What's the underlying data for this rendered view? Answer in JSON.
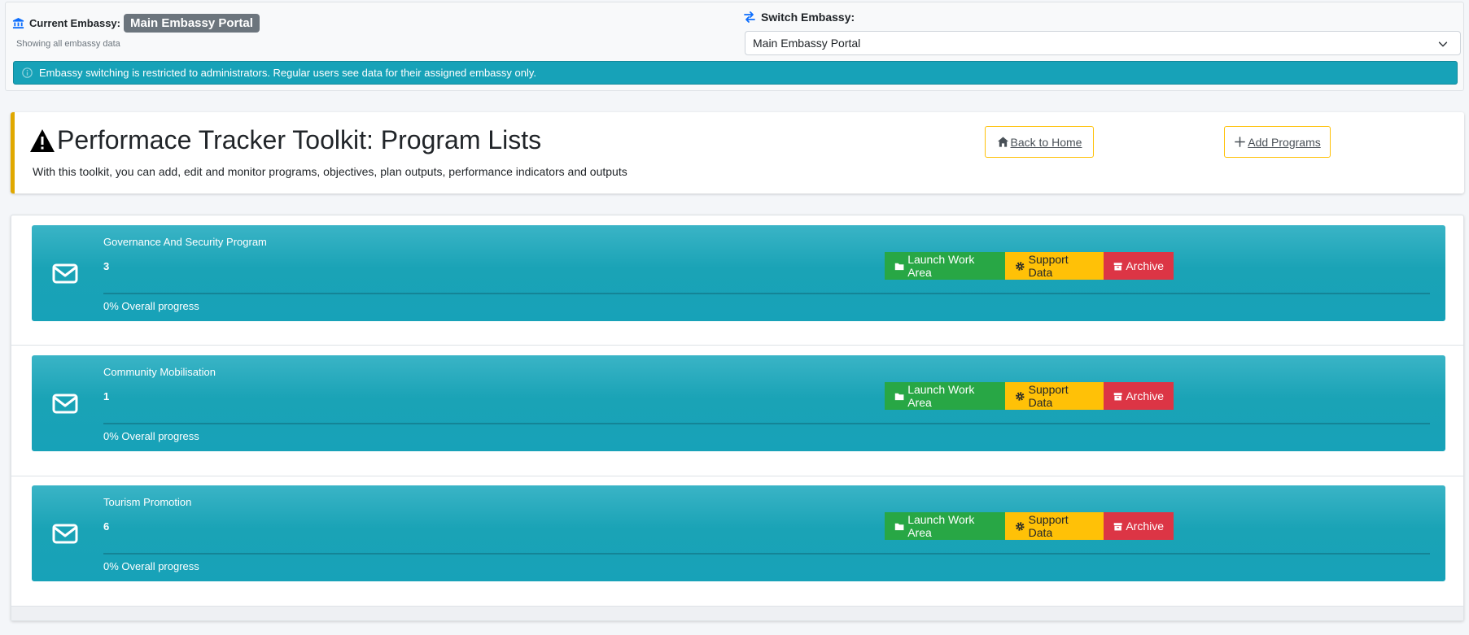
{
  "switcher": {
    "current_label": "Current Embassy:",
    "current_value": "Main Embassy Portal",
    "current_sub": "Showing all embassy data",
    "switch_label": "Switch Embassy:",
    "selected_option": "Main Embassy Portal",
    "notice": "Embassy switching is restricted to administrators. Regular users see data for their assigned embassy only."
  },
  "header": {
    "title": "Performace Tracker Toolkit: Program Lists",
    "subtitle": "With this toolkit, you can add, edit and monitor programs, objectives, plan outputs, performance indicators and outputs",
    "back_label": "Back to Home",
    "add_label": "Add Programs"
  },
  "programs": [
    {
      "name": "Governance And Security Program",
      "count": "3",
      "progress_text": "0% Overall progress",
      "progress": 0,
      "launch_label": "Launch Work Area",
      "support_label": "Support Data",
      "archive_label": "Archive"
    },
    {
      "name": "Community Mobilisation",
      "count": "1",
      "progress_text": "0% Overall progress",
      "progress": 0,
      "launch_label": "Launch Work Area",
      "support_label": "Support Data",
      "archive_label": "Archive"
    },
    {
      "name": "Tourism Promotion",
      "count": "6",
      "progress_text": "0% Overall progress",
      "progress": 0,
      "launch_label": "Launch Work Area",
      "support_label": "Support Data",
      "archive_label": "Archive"
    }
  ],
  "colors": {
    "info": "#17a2b8",
    "success": "#28a745",
    "warning": "#ffc107",
    "danger": "#dc3545",
    "secondary": "#6c757d"
  },
  "icons": {
    "current": "bank-icon",
    "switch": "swap-arrows-icon",
    "notice": "info-circle-icon",
    "title": "warning-triangle-icon",
    "back": "home-icon",
    "add": "plus-icon",
    "program": "envelope-icon",
    "launch": "folder-icon",
    "support": "gear-icon",
    "archive": "archive-box-icon"
  }
}
